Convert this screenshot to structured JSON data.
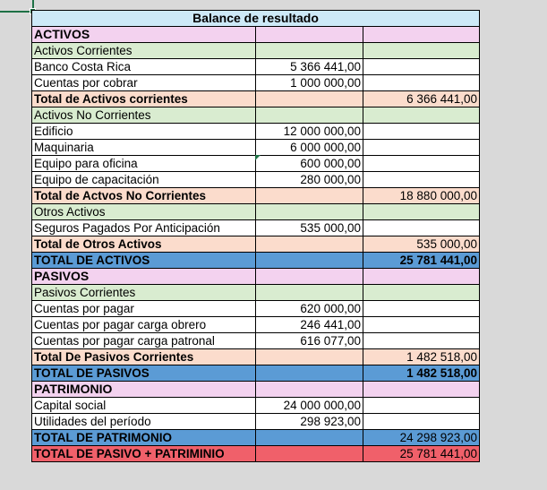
{
  "title": "Balance de resultado",
  "sections": [
    {
      "kind": "sec",
      "label": "ACTIVOS",
      "v1": "",
      "v2": ""
    },
    {
      "kind": "sub",
      "label": "Activos Corrientes",
      "v1": "",
      "v2": ""
    },
    {
      "kind": "row",
      "label": "Banco Costa Rica",
      "v1": "5 366 441,00",
      "v2": ""
    },
    {
      "kind": "row",
      "label": "Cuentas por cobrar",
      "v1": "1 000 000,00",
      "v2": ""
    },
    {
      "kind": "tot",
      "label": "Total de Activos corrientes",
      "v1": "",
      "v2": "6 366 441,00"
    },
    {
      "kind": "sub",
      "label": "Activos No Corrientes",
      "v1": "",
      "v2": ""
    },
    {
      "kind": "row",
      "label": "Edificio",
      "v1": "12 000 000,00",
      "v2": ""
    },
    {
      "kind": "row",
      "label": "Maquinaria",
      "v1": "6 000 000,00",
      "v2": ""
    },
    {
      "kind": "row",
      "label": "Equipo para oficina",
      "v1": "600 000,00",
      "v2": ""
    },
    {
      "kind": "row",
      "label": "Equipo de capacitación",
      "v1": "280 000,00",
      "v2": ""
    },
    {
      "kind": "tot",
      "label": "Total de Actvos No Corrientes",
      "v1": "",
      "v2": "18 880 000,00"
    },
    {
      "kind": "sub",
      "label": "Otros Activos",
      "v1": "",
      "v2": ""
    },
    {
      "kind": "row",
      "label": "Seguros Pagados Por Anticipación",
      "v1": "535 000,00",
      "v2": ""
    },
    {
      "kind": "tot",
      "label": "Total de Otros Activos",
      "v1": "",
      "v2": "535 000,00"
    },
    {
      "kind": "gtot boldv",
      "label": "TOTAL DE ACTIVOS",
      "v1": "",
      "v2": "25 781 441,00"
    },
    {
      "kind": "sec",
      "label": "PASIVOS",
      "v1": "",
      "v2": ""
    },
    {
      "kind": "sub",
      "label": "Pasivos Corrientes",
      "v1": "",
      "v2": ""
    },
    {
      "kind": "row",
      "label": "Cuentas por pagar",
      "v1": "620 000,00",
      "v2": ""
    },
    {
      "kind": "row",
      "label": "Cuentas por pagar carga obrero",
      "v1": "246 441,00",
      "v2": ""
    },
    {
      "kind": "row",
      "label": "Cuentas por pagar carga patronal",
      "v1": "616 077,00",
      "v2": ""
    },
    {
      "kind": "tot",
      "label": "Total De Pasivos Corrientes",
      "v1": "",
      "v2": "1 482 518,00"
    },
    {
      "kind": "gtot boldv",
      "label": "TOTAL DE PASIVOS",
      "v1": "",
      "v2": "1 482 518,00"
    },
    {
      "kind": "sec",
      "label": "PATRIMONIO",
      "v1": "",
      "v2": ""
    },
    {
      "kind": "row",
      "label": "Capital social",
      "v1": "24 000 000,00",
      "v2": ""
    },
    {
      "kind": "row",
      "label": "Utilidades del período",
      "v1": "298 923,00",
      "v2": ""
    },
    {
      "kind": "gtot",
      "label": "TOTAL DE PATRIMONIO",
      "v1": "",
      "v2": "24 298 923,00"
    },
    {
      "kind": "red",
      "label": "TOTAL DE PASIVO + PATRIMINIO",
      "v1": "",
      "v2": "25 781 441,00"
    }
  ],
  "colors": {
    "title": "#cde9f7",
    "section": "#f3d2ef",
    "subsection": "#d9ecd0",
    "subtotal": "#fbdccc",
    "grand_total": "#5b9bd5",
    "final_total": "#f0606a"
  }
}
